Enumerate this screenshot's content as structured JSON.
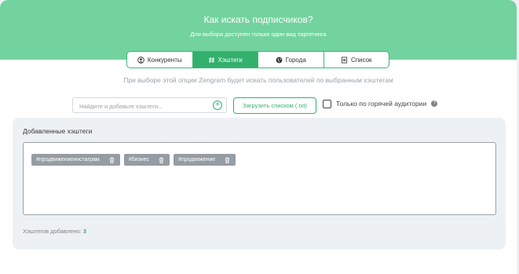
{
  "header": {
    "title": "Как искать подписчиков?",
    "subtitle": "Для выбора доступен только один вид таргетинга"
  },
  "tabs": [
    {
      "label": "Конкуренты",
      "icon": "user-circle-icon",
      "active": false
    },
    {
      "label": "Хэштеги",
      "icon": "hash-icon",
      "active": true
    },
    {
      "label": "Города",
      "icon": "globe-icon",
      "active": false
    },
    {
      "label": "Список",
      "icon": "list-icon",
      "active": false
    }
  ],
  "description": "При выборе этой опции Zengram будет искать пользователей по выбранным хэштегам",
  "search": {
    "placeholder": "Найдите и добавьте хэштеги...",
    "value": ""
  },
  "upload_button": "Загрузить списком (.txt)",
  "hot_audience": {
    "label": "Только по горячей аудитории",
    "checked": false
  },
  "panel": {
    "title": "Добавленные хэштеги",
    "tags": [
      "#продвижениеинстаграм",
      "#бизнес",
      "#продвижение"
    ],
    "count_label": "Хэштегов добавлено:",
    "count": "3"
  },
  "colors": {
    "header": "#72d39e",
    "accent": "#34b06d",
    "tag": "#969ca3",
    "panel": "#eef1f4"
  }
}
